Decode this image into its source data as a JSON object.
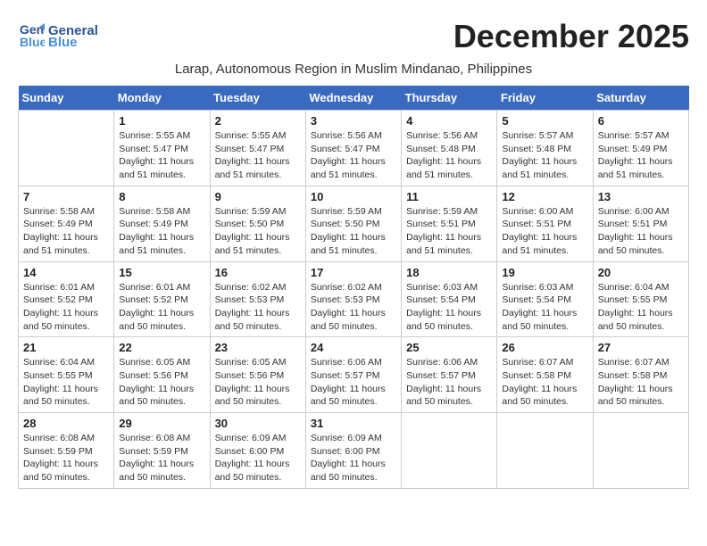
{
  "logo": {
    "line1": "General",
    "line2": "Blue"
  },
  "title": "December 2025",
  "location": "Larap, Autonomous Region in Muslim Mindanao, Philippines",
  "weekdays": [
    "Sunday",
    "Monday",
    "Tuesday",
    "Wednesday",
    "Thursday",
    "Friday",
    "Saturday"
  ],
  "weeks": [
    [
      {
        "day": "",
        "info": ""
      },
      {
        "day": "1",
        "info": "Sunrise: 5:55 AM\nSunset: 5:47 PM\nDaylight: 11 hours\nand 51 minutes."
      },
      {
        "day": "2",
        "info": "Sunrise: 5:55 AM\nSunset: 5:47 PM\nDaylight: 11 hours\nand 51 minutes."
      },
      {
        "day": "3",
        "info": "Sunrise: 5:56 AM\nSunset: 5:47 PM\nDaylight: 11 hours\nand 51 minutes."
      },
      {
        "day": "4",
        "info": "Sunrise: 5:56 AM\nSunset: 5:48 PM\nDaylight: 11 hours\nand 51 minutes."
      },
      {
        "day": "5",
        "info": "Sunrise: 5:57 AM\nSunset: 5:48 PM\nDaylight: 11 hours\nand 51 minutes."
      },
      {
        "day": "6",
        "info": "Sunrise: 5:57 AM\nSunset: 5:49 PM\nDaylight: 11 hours\nand 51 minutes."
      }
    ],
    [
      {
        "day": "7",
        "info": "Sunrise: 5:58 AM\nSunset: 5:49 PM\nDaylight: 11 hours\nand 51 minutes."
      },
      {
        "day": "8",
        "info": "Sunrise: 5:58 AM\nSunset: 5:49 PM\nDaylight: 11 hours\nand 51 minutes."
      },
      {
        "day": "9",
        "info": "Sunrise: 5:59 AM\nSunset: 5:50 PM\nDaylight: 11 hours\nand 51 minutes."
      },
      {
        "day": "10",
        "info": "Sunrise: 5:59 AM\nSunset: 5:50 PM\nDaylight: 11 hours\nand 51 minutes."
      },
      {
        "day": "11",
        "info": "Sunrise: 5:59 AM\nSunset: 5:51 PM\nDaylight: 11 hours\nand 51 minutes."
      },
      {
        "day": "12",
        "info": "Sunrise: 6:00 AM\nSunset: 5:51 PM\nDaylight: 11 hours\nand 51 minutes."
      },
      {
        "day": "13",
        "info": "Sunrise: 6:00 AM\nSunset: 5:51 PM\nDaylight: 11 hours\nand 50 minutes."
      }
    ],
    [
      {
        "day": "14",
        "info": "Sunrise: 6:01 AM\nSunset: 5:52 PM\nDaylight: 11 hours\nand 50 minutes."
      },
      {
        "day": "15",
        "info": "Sunrise: 6:01 AM\nSunset: 5:52 PM\nDaylight: 11 hours\nand 50 minutes."
      },
      {
        "day": "16",
        "info": "Sunrise: 6:02 AM\nSunset: 5:53 PM\nDaylight: 11 hours\nand 50 minutes."
      },
      {
        "day": "17",
        "info": "Sunrise: 6:02 AM\nSunset: 5:53 PM\nDaylight: 11 hours\nand 50 minutes."
      },
      {
        "day": "18",
        "info": "Sunrise: 6:03 AM\nSunset: 5:54 PM\nDaylight: 11 hours\nand 50 minutes."
      },
      {
        "day": "19",
        "info": "Sunrise: 6:03 AM\nSunset: 5:54 PM\nDaylight: 11 hours\nand 50 minutes."
      },
      {
        "day": "20",
        "info": "Sunrise: 6:04 AM\nSunset: 5:55 PM\nDaylight: 11 hours\nand 50 minutes."
      }
    ],
    [
      {
        "day": "21",
        "info": "Sunrise: 6:04 AM\nSunset: 5:55 PM\nDaylight: 11 hours\nand 50 minutes."
      },
      {
        "day": "22",
        "info": "Sunrise: 6:05 AM\nSunset: 5:56 PM\nDaylight: 11 hours\nand 50 minutes."
      },
      {
        "day": "23",
        "info": "Sunrise: 6:05 AM\nSunset: 5:56 PM\nDaylight: 11 hours\nand 50 minutes."
      },
      {
        "day": "24",
        "info": "Sunrise: 6:06 AM\nSunset: 5:57 PM\nDaylight: 11 hours\nand 50 minutes."
      },
      {
        "day": "25",
        "info": "Sunrise: 6:06 AM\nSunset: 5:57 PM\nDaylight: 11 hours\nand 50 minutes."
      },
      {
        "day": "26",
        "info": "Sunrise: 6:07 AM\nSunset: 5:58 PM\nDaylight: 11 hours\nand 50 minutes."
      },
      {
        "day": "27",
        "info": "Sunrise: 6:07 AM\nSunset: 5:58 PM\nDaylight: 11 hours\nand 50 minutes."
      }
    ],
    [
      {
        "day": "28",
        "info": "Sunrise: 6:08 AM\nSunset: 5:59 PM\nDaylight: 11 hours\nand 50 minutes."
      },
      {
        "day": "29",
        "info": "Sunrise: 6:08 AM\nSunset: 5:59 PM\nDaylight: 11 hours\nand 50 minutes."
      },
      {
        "day": "30",
        "info": "Sunrise: 6:09 AM\nSunset: 6:00 PM\nDaylight: 11 hours\nand 50 minutes."
      },
      {
        "day": "31",
        "info": "Sunrise: 6:09 AM\nSunset: 6:00 PM\nDaylight: 11 hours\nand 50 minutes."
      },
      {
        "day": "",
        "info": ""
      },
      {
        "day": "",
        "info": ""
      },
      {
        "day": "",
        "info": ""
      }
    ]
  ]
}
